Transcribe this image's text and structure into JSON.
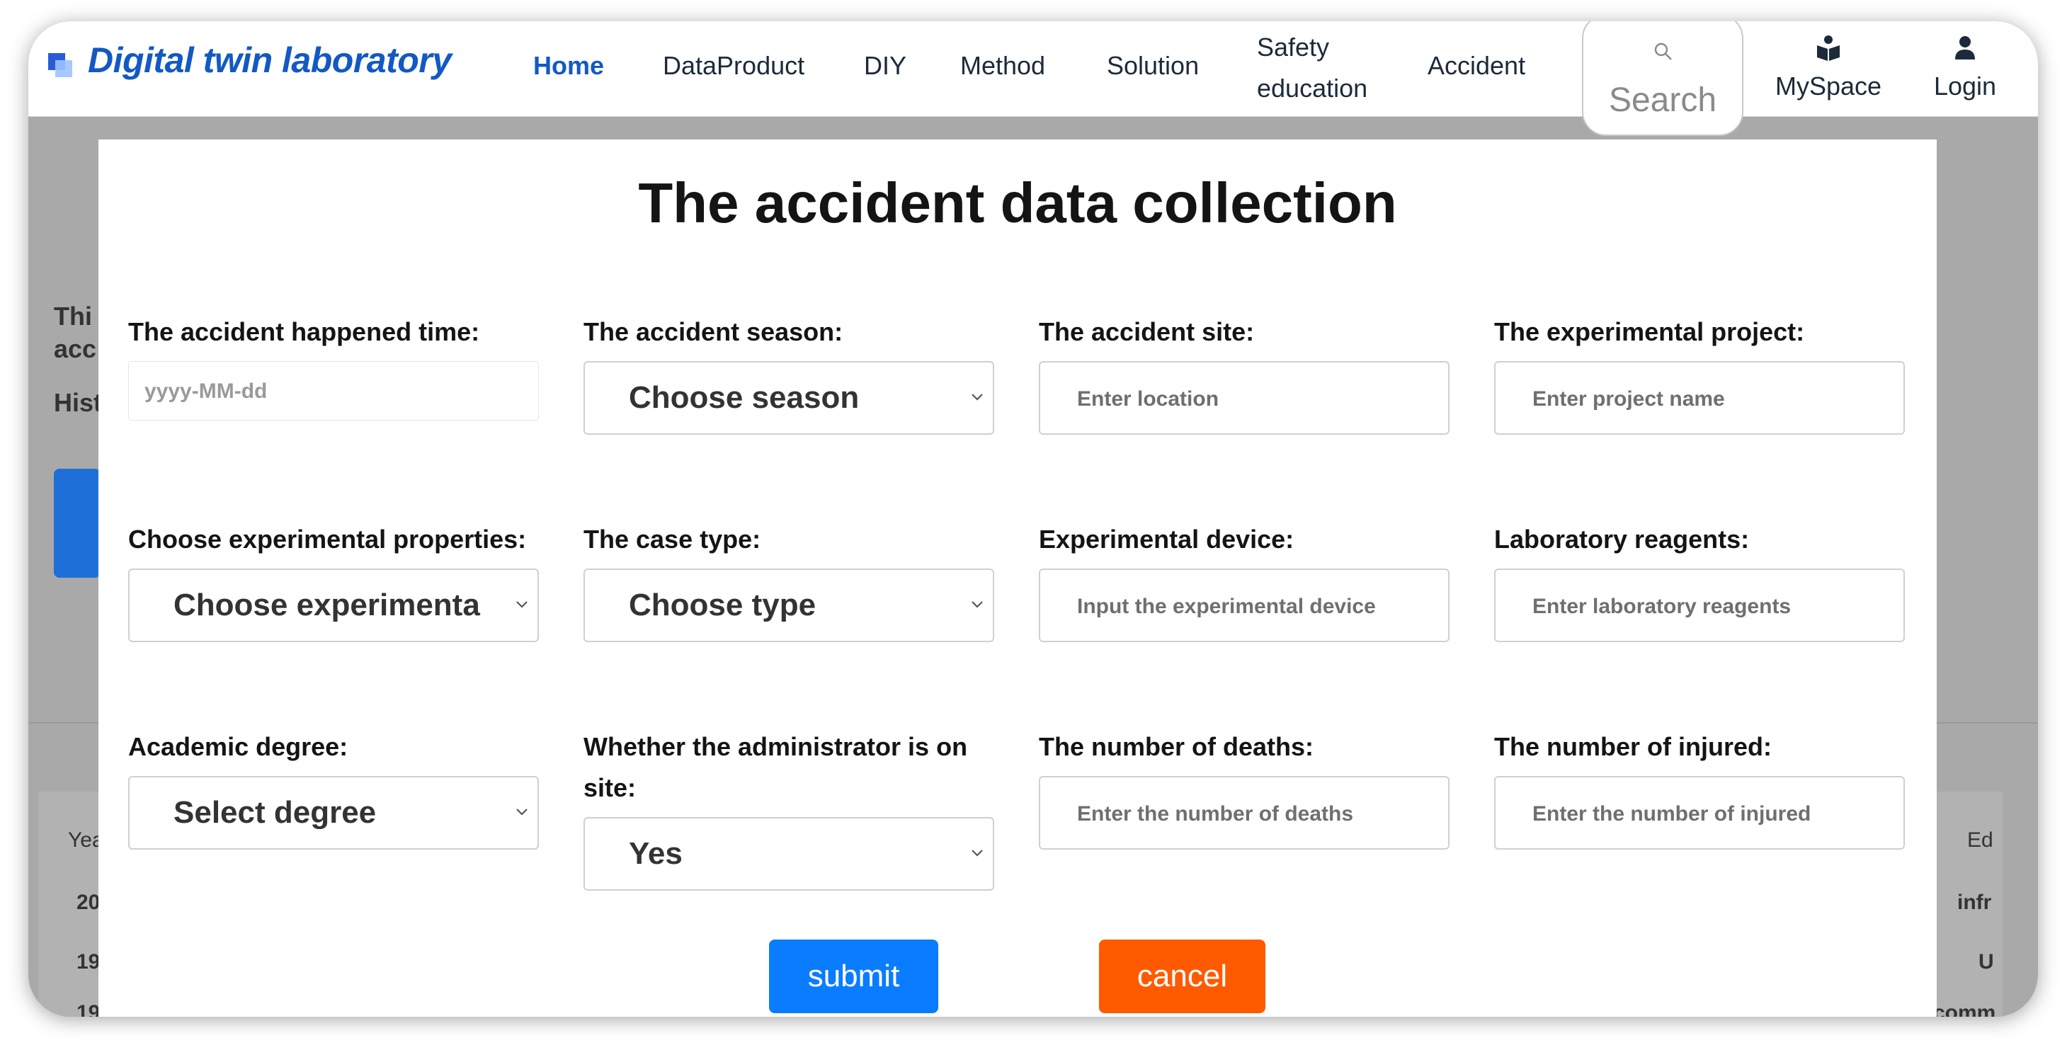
{
  "nav": {
    "logo": "Digital twin laboratory",
    "items": [
      "Home",
      "DataProduct",
      "DIY",
      "Method",
      "Solution"
    ],
    "safety_line1": "Safety",
    "safety_line2": "education",
    "accident": "Accident",
    "search_label": "Search",
    "myspace": "MySpace",
    "login": "Login",
    "accent_color": "#1259c3"
  },
  "background": {
    "intro_line1": "Thi",
    "intro_line2": "acc",
    "history": "Hist",
    "table_header_left": "Yea",
    "table_header_right": "Ed",
    "row1_left": "20",
    "row1_right": "infr",
    "row2_left": "19",
    "row2_right": "U",
    "row3_left": "19",
    "row3_right": "comm"
  },
  "modal": {
    "title": "The accident data collection",
    "fields": [
      {
        "label": "The accident happened time:",
        "type": "date",
        "placeholder": "yyyy-MM-dd"
      },
      {
        "label": "The accident season:",
        "type": "select",
        "value": "Choose season"
      },
      {
        "label": "The accident site:",
        "type": "text",
        "placeholder": "Enter location"
      },
      {
        "label": "The experimental project:",
        "type": "text",
        "placeholder": "Enter project name"
      },
      {
        "label": "Choose experimental properties:",
        "type": "select",
        "value": "Choose experimenta"
      },
      {
        "label": "The case type:",
        "type": "select",
        "value": "Choose type"
      },
      {
        "label": "Experimental device:",
        "type": "text",
        "placeholder": "Input the experimental device"
      },
      {
        "label": "Laboratory reagents:",
        "type": "text",
        "placeholder": "Enter laboratory reagents"
      },
      {
        "label": "Academic degree:",
        "type": "select",
        "value": "Select degree"
      },
      {
        "label": "Whether the administrator is on site:",
        "type": "select",
        "value": "Yes"
      },
      {
        "label": "The number of deaths:",
        "type": "text",
        "placeholder": "Enter the number of deaths"
      },
      {
        "label": "The number of injured:",
        "type": "text",
        "placeholder": "Enter the number of injured"
      }
    ],
    "submit_label": "submit",
    "cancel_label": "cancel",
    "submit_color": "#0a7cff",
    "cancel_color": "#ff5a00"
  }
}
